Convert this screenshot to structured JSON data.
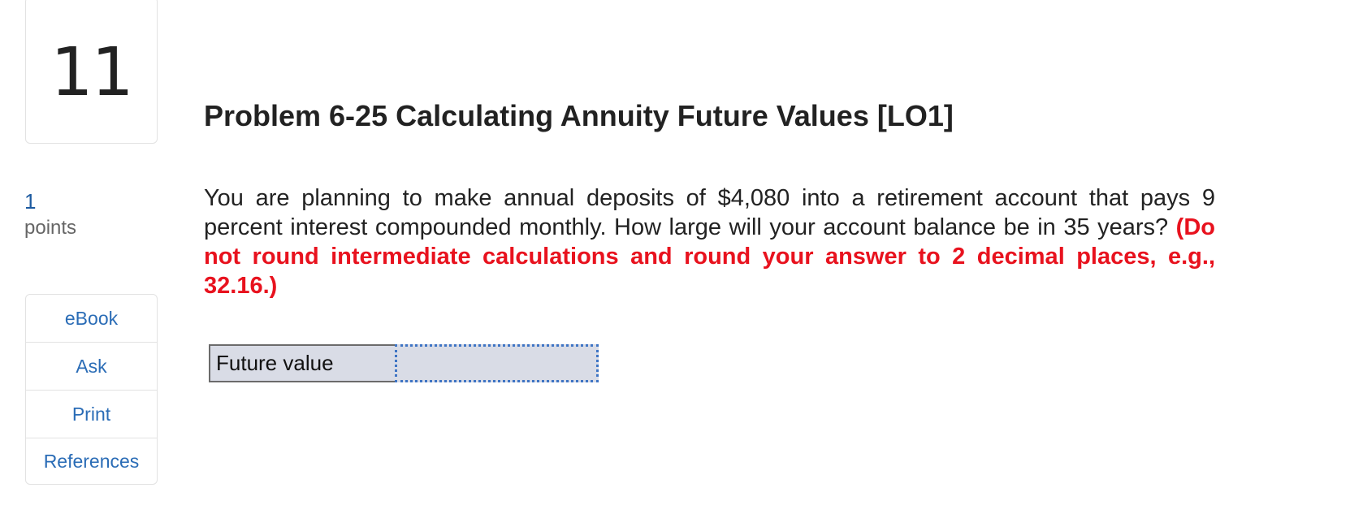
{
  "question_number": "11",
  "points": {
    "value": "1",
    "label": "points"
  },
  "side_menu": {
    "items": [
      {
        "label": "eBook"
      },
      {
        "label": "Ask"
      },
      {
        "label": "Print"
      },
      {
        "label": "References"
      }
    ]
  },
  "problem": {
    "title": "Problem 6-25 Calculating Annuity Future Values [LO1]",
    "text": "You are planning to make annual deposits of $4,080 into a retirement account that pays 9 percent interest compounded monthly. How large will your account balance be in 35 years? ",
    "instruction": "(Do not round intermediate calculations and round your answer to 2 decimal places, e.g., 32.16.)"
  },
  "answer": {
    "label": "Future value",
    "value": "",
    "placeholder": ""
  },
  "colors": {
    "accent_blue": "#2a6cb6",
    "instruction_red": "#e8121e",
    "input_bg": "#d9dce6"
  }
}
